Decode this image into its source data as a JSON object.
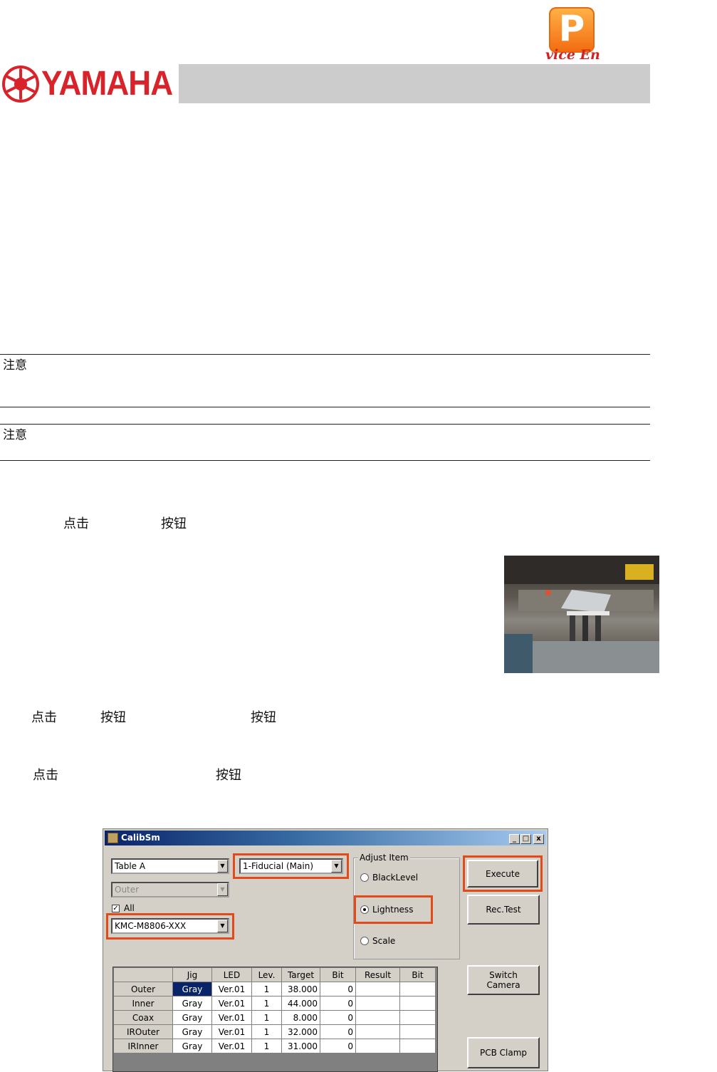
{
  "header": {
    "pdf_badge_letter": "P",
    "pdf_badge_text": "vice  En",
    "brand": "YAMAHA"
  },
  "notes": [
    {
      "label": "注意"
    },
    {
      "label": "注意"
    }
  ],
  "steps": {
    "step1": {
      "click": "点击",
      "button": "按钮"
    },
    "step2": {
      "click": "点击",
      "button1": "按钮",
      "button2": "按钮"
    },
    "step3": {
      "click": "点击",
      "button": "按钮"
    }
  },
  "window": {
    "title": "CalibSm",
    "controls": {
      "minimize": "_",
      "maximize": "□",
      "close": "x"
    },
    "table_select": "Table A",
    "fiducial_select": "1-Fiducial (Main)",
    "light_select": "Outer",
    "all_checkbox": {
      "label": "All",
      "checked": true
    },
    "model_select": "KMC-M8806-XXX",
    "adjust_group": {
      "label": "Adjust Item",
      "options": [
        "BlackLevel",
        "Lightness",
        "Scale"
      ],
      "selected": "Lightness"
    },
    "buttons": {
      "execute": "Execute",
      "rec_test": "Rec.Test",
      "switch_camera_line1": "Switch",
      "switch_camera_line2": "Camera",
      "pcb_clamp": "PCB Clamp"
    },
    "grid": {
      "columns": [
        "",
        "Jig",
        "LED",
        "Lev.",
        "Target",
        "Bit",
        "Result",
        "Bit"
      ],
      "rows": [
        {
          "name": "Outer",
          "jig": "Gray",
          "led": "Ver.01",
          "lev": "1",
          "target": "38.000",
          "bit": "0",
          "result": "",
          "bit2": ""
        },
        {
          "name": "Inner",
          "jig": "Gray",
          "led": "Ver.01",
          "lev": "1",
          "target": "44.000",
          "bit": "0",
          "result": "",
          "bit2": ""
        },
        {
          "name": "Coax",
          "jig": "Gray",
          "led": "Ver.01",
          "lev": "1",
          "target": "8.000",
          "bit": "0",
          "result": "",
          "bit2": ""
        },
        {
          "name": "IROuter",
          "jig": "Gray",
          "led": "Ver.01",
          "lev": "1",
          "target": "32.000",
          "bit": "0",
          "result": "",
          "bit2": ""
        },
        {
          "name": "IRInner",
          "jig": "Gray",
          "led": "Ver.01",
          "lev": "1",
          "target": "31.000",
          "bit": "0",
          "result": "",
          "bit2": ""
        }
      ]
    }
  },
  "colors": {
    "brand_red": "#d8232a",
    "header_bar": "#cccccc",
    "highlight": "#e24a1a",
    "titlebar": "#0a246a",
    "window_face": "#d4d0c8"
  }
}
